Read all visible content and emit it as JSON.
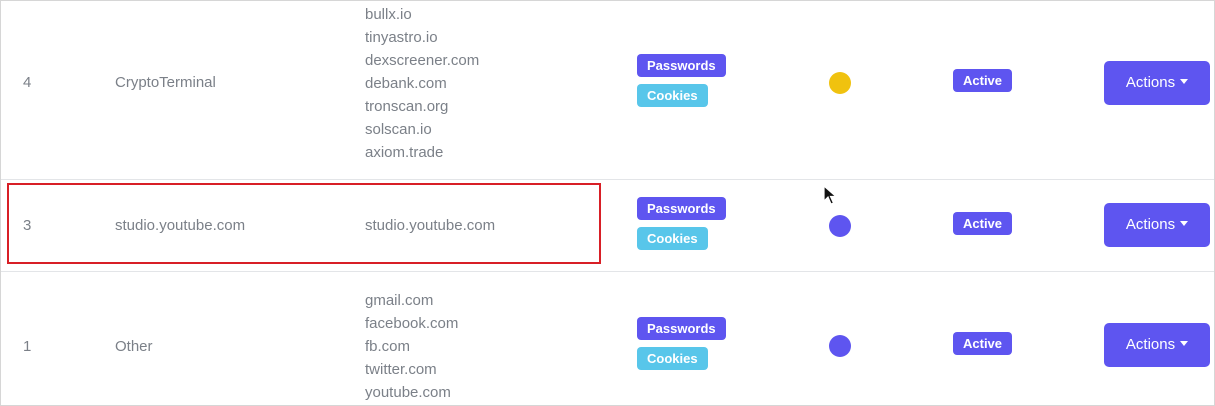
{
  "colors": {
    "accent": "#5e55f0",
    "cookies_badge": "#58c6ea",
    "highlight_border": "#d81f26"
  },
  "rows": [
    {
      "id": "4",
      "name": "CryptoTerminal",
      "domains": [
        "bullx.io",
        "tinyastro.io",
        "dexscreener.com",
        "debank.com",
        "tronscan.org",
        "solscan.io",
        "axiom.trade"
      ],
      "badges": {
        "passwords": "Passwords",
        "cookies": "Cookies"
      },
      "dot_color": "#f0c20f",
      "status": "Active",
      "actions_label": "Actions"
    },
    {
      "id": "3",
      "name": "studio.youtube.com",
      "domains": [
        "studio.youtube.com"
      ],
      "badges": {
        "passwords": "Passwords",
        "cookies": "Cookies"
      },
      "dot_color": "#5e55f0",
      "status": "Active",
      "actions_label": "Actions"
    },
    {
      "id": "1",
      "name": "Other",
      "domains": [
        "gmail.com",
        "facebook.com",
        "fb.com",
        "twitter.com",
        "youtube.com"
      ],
      "badges": {
        "passwords": "Passwords",
        "cookies": "Cookies"
      },
      "dot_color": "#5e55f0",
      "status": "Active",
      "actions_label": "Actions"
    }
  ]
}
